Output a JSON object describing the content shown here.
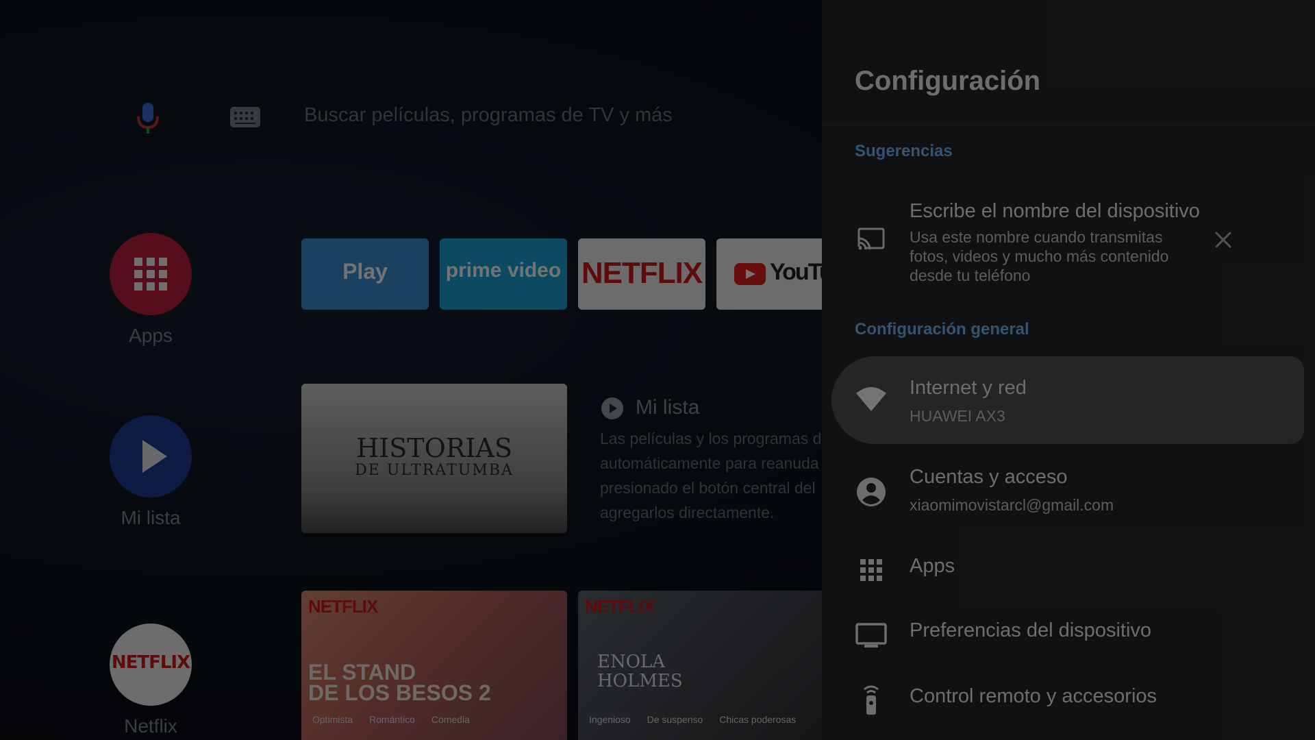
{
  "home": {
    "search_placeholder": "Buscar películas, programas de TV y más",
    "sidebar": [
      {
        "label": "Apps",
        "icon": "apps-grid-icon"
      },
      {
        "label": "Mi lista",
        "icon": "play-icon"
      },
      {
        "label": "Netflix",
        "icon": "netflix-logo"
      }
    ],
    "favorite_apps": [
      {
        "label": "Play",
        "icon": "movistar-play-logo"
      },
      {
        "label": "prime video",
        "icon": "prime-video-logo"
      },
      {
        "label": "NETFLIX",
        "icon": "netflix-logo"
      },
      {
        "label": "YouTube",
        "icon": "youtube-logo"
      }
    ],
    "netflix_brand": "NETFLIX",
    "mi_lista": {
      "poster_title": "HISTORIAS",
      "poster_subtitle": "DE ULTRATUMBA",
      "title": "Mi lista",
      "description_lines": [
        "Las películas y los programas d",
        "automáticamente para reanuda",
        "presionado el botón central del",
        "agregarlos directamente."
      ]
    },
    "netflix_row": [
      {
        "brand": "NETFLIX",
        "title_line1": "EL STAND",
        "title_line2": "DE LOS BESOS 2",
        "tags": [
          "Optimista",
          "Romántico",
          "Comedia"
        ]
      },
      {
        "brand": "NETFLIX",
        "title_line1": "ENOLA",
        "title_line2": "HOLMES",
        "tags": [
          "Ingenioso",
          "De suspenso",
          "Chicas poderosas"
        ]
      }
    ]
  },
  "settings": {
    "title": "Configuración",
    "suggestions_label": "Sugerencias",
    "suggestion": {
      "title": "Escribe el nombre del dispositivo",
      "description": "Usa este nombre cuando transmitas fotos, videos y mucho más contenido desde tu teléfono",
      "icon": "cast-icon",
      "dismiss_icon": "close-icon"
    },
    "general_label": "Configuración general",
    "items": [
      {
        "title": "Internet y red",
        "subtitle": "HUAWEI AX3",
        "icon": "wifi-icon",
        "focused": true
      },
      {
        "title": "Cuentas y acceso",
        "subtitle": "xiaomimovistarcl@gmail.com",
        "icon": "account-circle-icon"
      },
      {
        "title": "Apps",
        "icon": "apps-grid-icon"
      },
      {
        "title": "Preferencias del dispositivo",
        "icon": "tv-icon"
      },
      {
        "title": "Control remoto y accesorios",
        "icon": "remote-icon"
      }
    ],
    "colors": {
      "panel_bg": "#25272b",
      "section_label": "#6fbdff",
      "focus_bg": "#4f5257"
    }
  }
}
